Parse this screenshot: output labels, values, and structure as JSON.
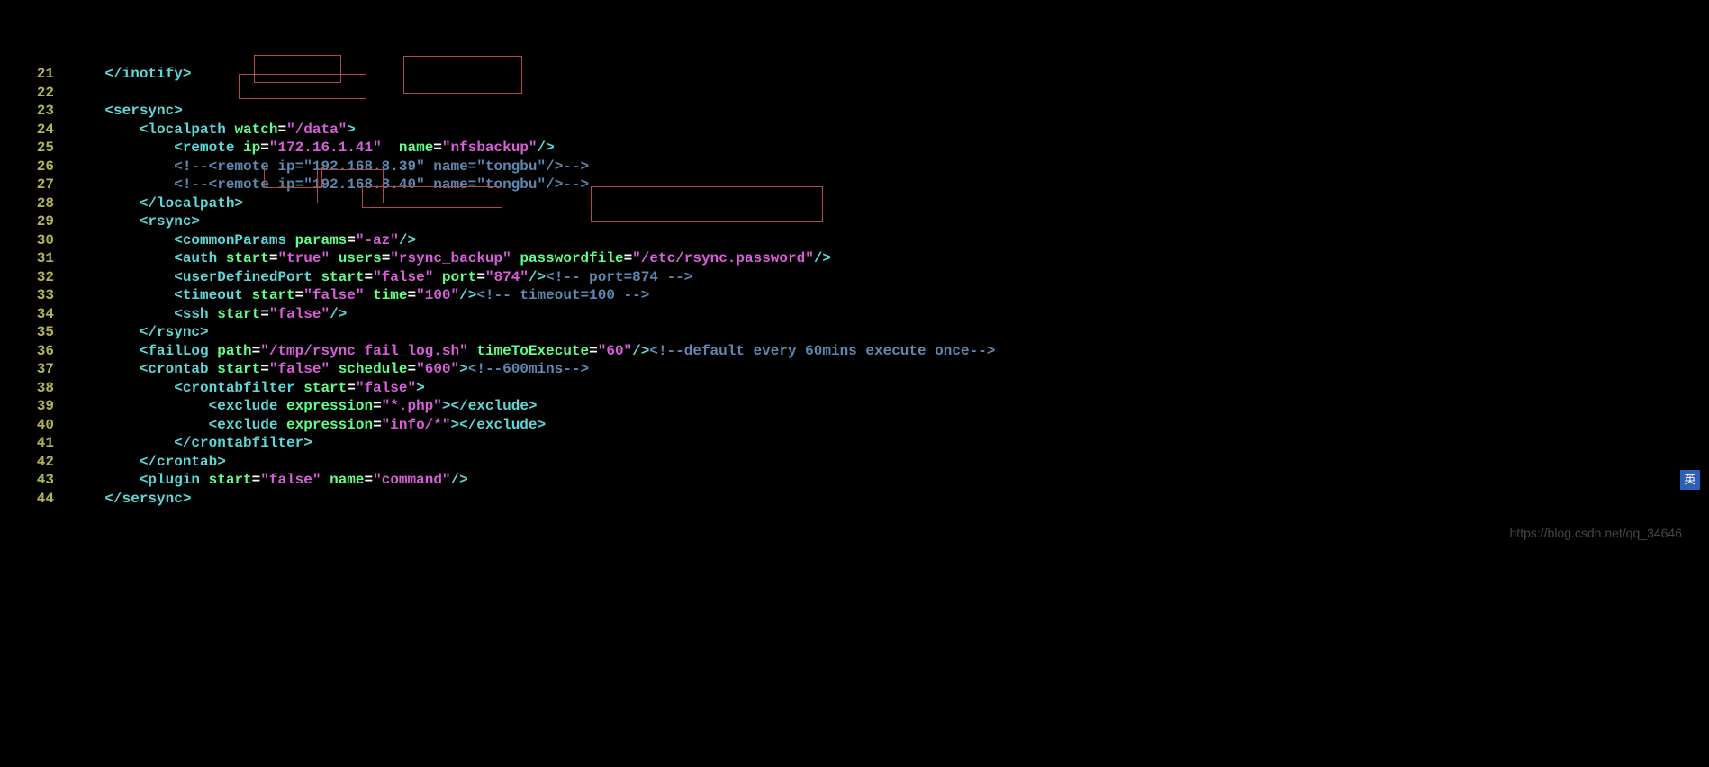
{
  "watermark": "https://blog.csdn.net/qq_34646",
  "ime_label": "英",
  "lines": [
    {
      "n": "21",
      "tokens": [
        {
          "t": "    ",
          "c": "c-white"
        },
        {
          "t": "</inotify>",
          "c": "c-cyan"
        }
      ]
    },
    {
      "n": "22",
      "tokens": []
    },
    {
      "n": "23",
      "tokens": [
        {
          "t": "    ",
          "c": "c-white"
        },
        {
          "t": "<sersync>",
          "c": "c-cyan"
        }
      ]
    },
    {
      "n": "24",
      "tokens": [
        {
          "t": "        ",
          "c": "c-white"
        },
        {
          "t": "<localpath",
          "c": "c-cyan"
        },
        {
          "t": " ",
          "c": "c-white"
        },
        {
          "t": "watch",
          "c": "c-green"
        },
        {
          "t": "=",
          "c": "c-white"
        },
        {
          "t": "\"/data\"",
          "c": "c-pink"
        },
        {
          "t": ">",
          "c": "c-cyan"
        }
      ]
    },
    {
      "n": "25",
      "tokens": [
        {
          "t": "            ",
          "c": "c-white"
        },
        {
          "t": "<remote",
          "c": "c-cyan"
        },
        {
          "t": " ",
          "c": "c-white"
        },
        {
          "t": "ip",
          "c": "c-green"
        },
        {
          "t": "=",
          "c": "c-white"
        },
        {
          "t": "\"172.16.1.41\"",
          "c": "c-pink"
        },
        {
          "t": "  ",
          "c": "c-white"
        },
        {
          "t": "name",
          "c": "c-green"
        },
        {
          "t": "=",
          "c": "c-white"
        },
        {
          "t": "\"nfsbackup\"",
          "c": "c-pink"
        },
        {
          "t": "/>",
          "c": "c-cyan"
        }
      ]
    },
    {
      "n": "26",
      "tokens": [
        {
          "t": "            ",
          "c": "c-white"
        },
        {
          "t": "<!--<remote ip=\"192.168.8.39\" name=\"tongbu\"/>-->",
          "c": "c-gray"
        }
      ]
    },
    {
      "n": "27",
      "tokens": [
        {
          "t": "            ",
          "c": "c-white"
        },
        {
          "t": "<!--<remote ip=\"192.168.8.40\" name=\"tongbu\"/>-->",
          "c": "c-gray"
        }
      ]
    },
    {
      "n": "28",
      "tokens": [
        {
          "t": "        ",
          "c": "c-white"
        },
        {
          "t": "</localpath>",
          "c": "c-cyan"
        }
      ]
    },
    {
      "n": "29",
      "tokens": [
        {
          "t": "        ",
          "c": "c-white"
        },
        {
          "t": "<rsync>",
          "c": "c-cyan"
        }
      ]
    },
    {
      "n": "30",
      "tokens": [
        {
          "t": "            ",
          "c": "c-white"
        },
        {
          "t": "<commonParams",
          "c": "c-cyan"
        },
        {
          "t": " ",
          "c": "c-white"
        },
        {
          "t": "params",
          "c": "c-green"
        },
        {
          "t": "=",
          "c": "c-white"
        },
        {
          "t": "\"-az\"",
          "c": "c-pink"
        },
        {
          "t": "/>",
          "c": "c-cyan"
        }
      ]
    },
    {
      "n": "31",
      "tokens": [
        {
          "t": "            ",
          "c": "c-white"
        },
        {
          "t": "<auth",
          "c": "c-cyan"
        },
        {
          "t": " ",
          "c": "c-white"
        },
        {
          "t": "start",
          "c": "c-green"
        },
        {
          "t": "=",
          "c": "c-white"
        },
        {
          "t": "\"true\"",
          "c": "c-pink"
        },
        {
          "t": " ",
          "c": "c-white"
        },
        {
          "t": "users",
          "c": "c-green"
        },
        {
          "t": "=",
          "c": "c-white"
        },
        {
          "t": "\"rsync_backup\"",
          "c": "c-pink"
        },
        {
          "t": " ",
          "c": "c-white"
        },
        {
          "t": "passwordfile",
          "c": "c-green"
        },
        {
          "t": "=",
          "c": "c-white"
        },
        {
          "t": "\"/etc/rsync.password\"",
          "c": "c-pink"
        },
        {
          "t": "/>",
          "c": "c-cyan"
        }
      ]
    },
    {
      "n": "32",
      "tokens": [
        {
          "t": "            ",
          "c": "c-white"
        },
        {
          "t": "<userDefinedPort",
          "c": "c-cyan"
        },
        {
          "t": " ",
          "c": "c-white"
        },
        {
          "t": "start",
          "c": "c-green"
        },
        {
          "t": "=",
          "c": "c-white"
        },
        {
          "t": "\"false\"",
          "c": "c-pink"
        },
        {
          "t": " ",
          "c": "c-white"
        },
        {
          "t": "port",
          "c": "c-green"
        },
        {
          "t": "=",
          "c": "c-white"
        },
        {
          "t": "\"874\"",
          "c": "c-pink"
        },
        {
          "t": "/>",
          "c": "c-cyan"
        },
        {
          "t": "<!-- port=874 -->",
          "c": "c-gray"
        }
      ]
    },
    {
      "n": "33",
      "tokens": [
        {
          "t": "            ",
          "c": "c-white"
        },
        {
          "t": "<timeout",
          "c": "c-cyan"
        },
        {
          "t": " ",
          "c": "c-white"
        },
        {
          "t": "start",
          "c": "c-green"
        },
        {
          "t": "=",
          "c": "c-white"
        },
        {
          "t": "\"false\"",
          "c": "c-pink"
        },
        {
          "t": " ",
          "c": "c-white"
        },
        {
          "t": "time",
          "c": "c-green"
        },
        {
          "t": "=",
          "c": "c-white"
        },
        {
          "t": "\"100\"",
          "c": "c-pink"
        },
        {
          "t": "/>",
          "c": "c-cyan"
        },
        {
          "t": "<!-- timeout=100 -->",
          "c": "c-gray"
        }
      ]
    },
    {
      "n": "34",
      "tokens": [
        {
          "t": "            ",
          "c": "c-white"
        },
        {
          "t": "<ssh",
          "c": "c-cyan"
        },
        {
          "t": " ",
          "c": "c-white"
        },
        {
          "t": "start",
          "c": "c-green"
        },
        {
          "t": "=",
          "c": "c-white"
        },
        {
          "t": "\"false\"",
          "c": "c-pink"
        },
        {
          "t": "/>",
          "c": "c-cyan"
        }
      ]
    },
    {
      "n": "35",
      "tokens": [
        {
          "t": "        ",
          "c": "c-white"
        },
        {
          "t": "</rsync>",
          "c": "c-cyan"
        }
      ]
    },
    {
      "n": "36",
      "tokens": [
        {
          "t": "        ",
          "c": "c-white"
        },
        {
          "t": "<failLog",
          "c": "c-cyan"
        },
        {
          "t": " ",
          "c": "c-white"
        },
        {
          "t": "path",
          "c": "c-green"
        },
        {
          "t": "=",
          "c": "c-white"
        },
        {
          "t": "\"/tmp/rsync_fail_log.sh\"",
          "c": "c-pink"
        },
        {
          "t": " ",
          "c": "c-white"
        },
        {
          "t": "timeToExecute",
          "c": "c-green"
        },
        {
          "t": "=",
          "c": "c-white"
        },
        {
          "t": "\"60\"",
          "c": "c-pink"
        },
        {
          "t": "/>",
          "c": "c-cyan"
        },
        {
          "t": "<!--default every 60mins execute once-->",
          "c": "c-gray"
        }
      ]
    },
    {
      "n": "37",
      "tokens": [
        {
          "t": "        ",
          "c": "c-white"
        },
        {
          "t": "<crontab",
          "c": "c-cyan"
        },
        {
          "t": " ",
          "c": "c-white"
        },
        {
          "t": "start",
          "c": "c-green"
        },
        {
          "t": "=",
          "c": "c-white"
        },
        {
          "t": "\"false\"",
          "c": "c-pink"
        },
        {
          "t": " ",
          "c": "c-white"
        },
        {
          "t": "schedule",
          "c": "c-green"
        },
        {
          "t": "=",
          "c": "c-white"
        },
        {
          "t": "\"600\"",
          "c": "c-pink"
        },
        {
          "t": ">",
          "c": "c-cyan"
        },
        {
          "t": "<!--600mins-->",
          "c": "c-gray"
        }
      ]
    },
    {
      "n": "38",
      "tokens": [
        {
          "t": "            ",
          "c": "c-white"
        },
        {
          "t": "<crontabfilter",
          "c": "c-cyan"
        },
        {
          "t": " ",
          "c": "c-white"
        },
        {
          "t": "start",
          "c": "c-green"
        },
        {
          "t": "=",
          "c": "c-white"
        },
        {
          "t": "\"false\"",
          "c": "c-pink"
        },
        {
          "t": ">",
          "c": "c-cyan"
        }
      ]
    },
    {
      "n": "39",
      "tokens": [
        {
          "t": "                ",
          "c": "c-white"
        },
        {
          "t": "<exclude",
          "c": "c-cyan"
        },
        {
          "t": " ",
          "c": "c-white"
        },
        {
          "t": "expression",
          "c": "c-green"
        },
        {
          "t": "=",
          "c": "c-white"
        },
        {
          "t": "\"*.php\"",
          "c": "c-pink"
        },
        {
          "t": ">",
          "c": "c-cyan"
        },
        {
          "t": "</exclude>",
          "c": "c-cyan"
        }
      ]
    },
    {
      "n": "40",
      "tokens": [
        {
          "t": "                ",
          "c": "c-white"
        },
        {
          "t": "<exclude",
          "c": "c-cyan"
        },
        {
          "t": " ",
          "c": "c-white"
        },
        {
          "t": "expression",
          "c": "c-green"
        },
        {
          "t": "=",
          "c": "c-white"
        },
        {
          "t": "\"info/*\"",
          "c": "c-pink"
        },
        {
          "t": ">",
          "c": "c-cyan"
        },
        {
          "t": "</exclude>",
          "c": "c-cyan"
        }
      ]
    },
    {
      "n": "41",
      "tokens": [
        {
          "t": "            ",
          "c": "c-white"
        },
        {
          "t": "</crontabfilter>",
          "c": "c-cyan"
        }
      ]
    },
    {
      "n": "42",
      "tokens": [
        {
          "t": "        ",
          "c": "c-white"
        },
        {
          "t": "</crontab>",
          "c": "c-cyan"
        }
      ]
    },
    {
      "n": "43",
      "tokens": [
        {
          "t": "        ",
          "c": "c-white"
        },
        {
          "t": "<plugin",
          "c": "c-cyan"
        },
        {
          "t": " ",
          "c": "c-white"
        },
        {
          "t": "start",
          "c": "c-green"
        },
        {
          "t": "=",
          "c": "c-white"
        },
        {
          "t": "\"false\"",
          "c": "c-pink"
        },
        {
          "t": " ",
          "c": "c-white"
        },
        {
          "t": "name",
          "c": "c-green"
        },
        {
          "t": "=",
          "c": "c-white"
        },
        {
          "t": "\"command\"",
          "c": "c-pink"
        },
        {
          "t": "/>",
          "c": "c-cyan"
        }
      ]
    },
    {
      "n": "44",
      "tokens": [
        {
          "t": "    ",
          "c": "c-white"
        },
        {
          "t": "</sersync>",
          "c": "c-cyan"
        }
      ]
    }
  ]
}
